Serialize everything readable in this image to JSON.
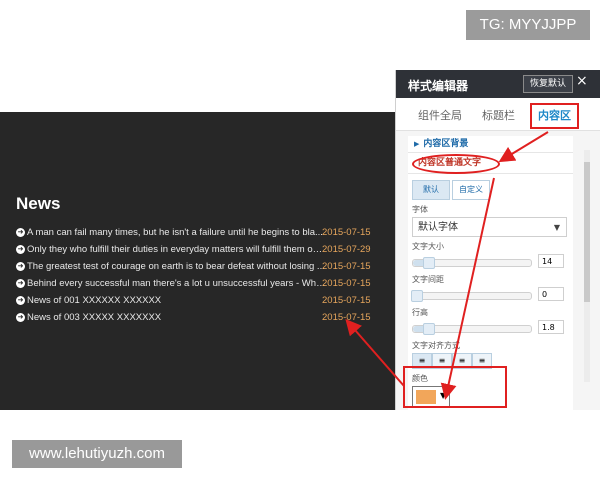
{
  "watermark_tg": "TG: MYYJJPP",
  "watermark_url": "www.lehutiyuzh.com",
  "news": {
    "title": "News",
    "items": [
      {
        "headline": "A man can fail many times, but he isn't a failure until he begins to bla...",
        "date": "2015-07-15"
      },
      {
        "headline": "Only they who fulfill their duties in everyday matters will fulfill them on ...",
        "date": "2015-07-29"
      },
      {
        "headline": "The greatest test of courage on earth is to bear defeat without losing ...",
        "date": "2015-07-15"
      },
      {
        "headline": "Behind every successful man there's a lot u unsuccessful years - Whil...",
        "date": "2015-07-15"
      },
      {
        "headline": "News of 001 XXXXXX XXXXXX",
        "date": "2015-07-15"
      },
      {
        "headline": "News of 003 XXXXX XXXXXXX",
        "date": "2015-07-15"
      }
    ]
  },
  "editor": {
    "title": "样式编辑器",
    "restore_label": "恢复默认",
    "close_icon": "×",
    "tabs": [
      "组件全局",
      "标题栏",
      "内容区"
    ],
    "section_background": "内容区背景",
    "section_text": "内容区普通文字",
    "subtabs": [
      "默认",
      "自定义"
    ],
    "font_label": "字体",
    "font_value": "默认字体",
    "font_size_label": "文字大小",
    "font_size_value": "14",
    "letter_spacing_label": "文字间距",
    "letter_spacing_value": "0",
    "line_height_label": "行高",
    "line_height_value": "1.8",
    "align_label": "文字对齐方式",
    "color_label": "颜色",
    "color_value": "#f2a65a"
  },
  "colors": {
    "panel_bg": "#272727",
    "date_color": "#e6a65c",
    "annotation_red": "#e02020",
    "active_tab_blue": "#1e88c8"
  }
}
